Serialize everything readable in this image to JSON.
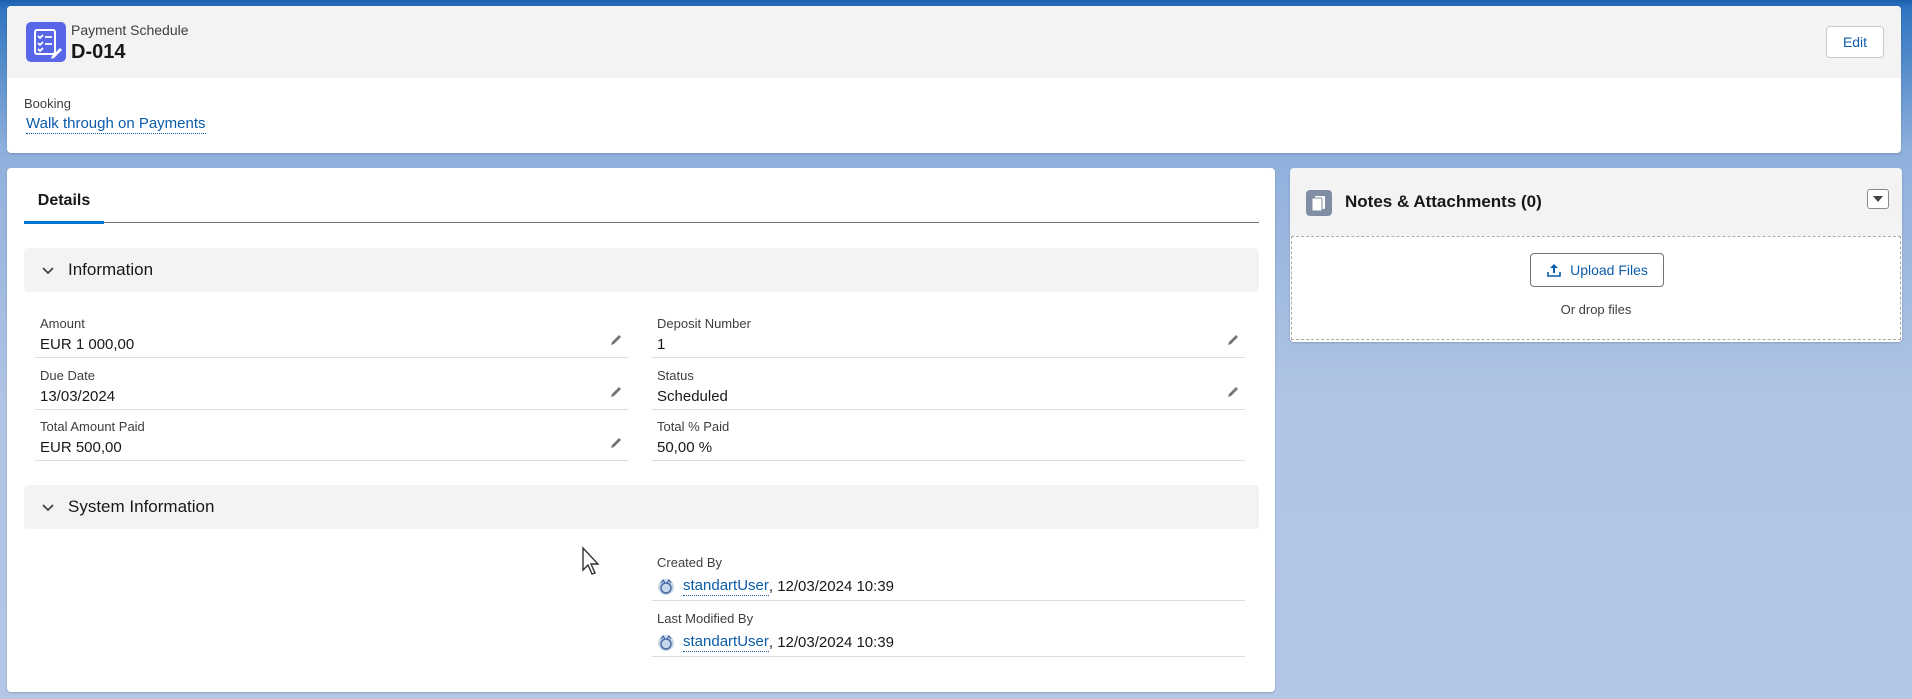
{
  "header": {
    "object_label": "Payment Schedule",
    "record_name": "D-014",
    "edit_label": "Edit",
    "booking_label": "Booking",
    "booking_value": "Walk through on Payments"
  },
  "details": {
    "tab_label": "Details",
    "information": {
      "title": "Information",
      "fields": [
        {
          "label": "Amount",
          "value": "EUR 1 000,00"
        },
        {
          "label": "Deposit Number",
          "value": "1"
        },
        {
          "label": "Due Date",
          "value": "13/03/2024"
        },
        {
          "label": "Status",
          "value": "Scheduled"
        },
        {
          "label": "Total Amount Paid",
          "value": "EUR 500,00"
        },
        {
          "label": "Total % Paid",
          "value": "50,00 %"
        }
      ]
    },
    "system_information": {
      "title": "System Information",
      "created_by": {
        "label": "Created By",
        "user": "standartUser",
        "timestamp": ", 12/03/2024 10:39"
      },
      "last_modified_by": {
        "label": "Last Modified By",
        "user": "standartUser",
        "timestamp": ", 12/03/2024 10:39"
      }
    }
  },
  "notes": {
    "title": "Notes & Attachments (0)",
    "upload_label": "Upload Files",
    "drop_text": "Or drop files"
  },
  "colors": {
    "brand": "#0176d3",
    "link": "#0b5cab",
    "record_icon": "#5867e8"
  }
}
